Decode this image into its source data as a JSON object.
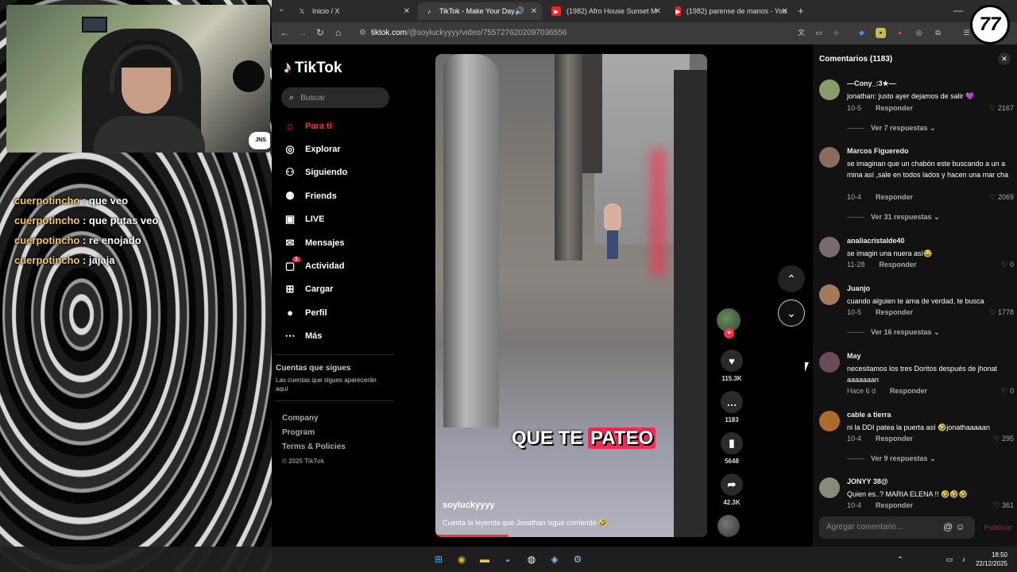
{
  "stream": {
    "chat": [
      {
        "user": "cuerpotincho",
        "msg": ": que veo"
      },
      {
        "user": "cuerpotincho",
        "msg": ": que putas veo"
      },
      {
        "user": "cuerpotincho",
        "msg": ": re enojado"
      },
      {
        "user": "cuerpotincho",
        "msg": ": jajaja"
      }
    ],
    "webcam_badge": "JNS",
    "logo": "77"
  },
  "browser": {
    "tabs": [
      {
        "label": "Inicio / X",
        "icon": "x-logo-icon",
        "active": false
      },
      {
        "label": "TikTok - Make Your Day",
        "icon": "tiktok-logo-icon",
        "active": true
      },
      {
        "label": "(1982) Afro House Sunset M",
        "icon": "youtube-icon",
        "active": false
      },
      {
        "label": "(1982) parense de manos - You",
        "icon": "youtube-icon",
        "active": false
      }
    ],
    "url_host": "tiktok.com",
    "url_path": "/@soyluckyyyy/video/7557276202097036556"
  },
  "tiktok": {
    "logo": "TikTok",
    "search_placeholder": "Buscar",
    "nav": [
      {
        "label": "Para ti",
        "icon": "home-icon",
        "active": true
      },
      {
        "label": "Explorar",
        "icon": "compass-icon"
      },
      {
        "label": "Siguiendo",
        "icon": "following-icon"
      },
      {
        "label": "Friends",
        "icon": "friends-icon"
      },
      {
        "label": "LIVE",
        "icon": "live-icon"
      },
      {
        "label": "Mensajes",
        "icon": "messages-icon"
      },
      {
        "label": "Actividad",
        "icon": "activity-icon",
        "badge": "1"
      },
      {
        "label": "Cargar",
        "icon": "upload-icon"
      },
      {
        "label": "Perfil",
        "icon": "profile-icon"
      },
      {
        "label": "Más",
        "icon": "more-icon"
      }
    ],
    "following_title": "Cuentas que sigues",
    "following_sub": "Las cuentas que sigues aparecerán aquí",
    "footer": {
      "company": "Company",
      "program": "Program",
      "terms": "Terms & Policies",
      "copyright": "© 2025 TikTok"
    },
    "video": {
      "caption_a": "QUE TE ",
      "caption_b": "PATEO",
      "author": "soyluckyyyy",
      "description": "Cuenta la leyenda que Jonathan sigue corriendo 🤣",
      "progress": 0.27
    },
    "actions": {
      "likes": "115.3K",
      "comments": "1183",
      "saves": "5648",
      "shares": "42.3K"
    }
  },
  "comments": {
    "title": "Comentarios (1183)",
    "input_placeholder": "Agregar comentario...",
    "post_label": "Publicar",
    "reply_label": "Responder",
    "items": [
      {
        "name": "—Cony_:3★—",
        "text": "jonathan: justo ayer dejamos de salir 💜",
        "date": "10-5",
        "likes": "2167",
        "more": "Ver 7 respuestas",
        "color": "#8a9b6a"
      },
      {
        "name": "Marcos Figueredo",
        "text": "se imaginan que un chabón este buscando a un a mina así ,sale en todos lados y hacen una mar cha",
        "date": "10-4",
        "likes": "2069",
        "more": "Ver 31 respuestas",
        "color": "#8a6b5c"
      },
      {
        "name": "analiacristalde40",
        "text": "se imagin una nuera así😂",
        "date": "11-28",
        "likes": "0",
        "more": "",
        "color": "#7b6a6e"
      },
      {
        "name": "Juanjo",
        "text": "cuando alguien te ama de verdad, te busca",
        "date": "10-5",
        "likes": "1778",
        "more": "Ver 16 respuestas",
        "color": "#a27a5c"
      },
      {
        "name": "May",
        "text": "necesitamos los tres Doritos después de jhonat aaaaaaan",
        "date": "Hace 6 d",
        "likes": "0",
        "more": "",
        "color": "#6b4a5c"
      },
      {
        "name": "cable a tierra",
        "text": "ni la DDI patea la puerta así 🤣jonathaaaaan",
        "date": "10-4",
        "likes": "295",
        "more": "Ver 9 respuestas",
        "color": "#b06a2a"
      },
      {
        "name": "JONYY 38@",
        "text": "Quien es..? MARIA ELENA !! 🤣🤣🤣",
        "date": "10-4",
        "likes": "361",
        "more": "",
        "color": "#8a8a7a"
      }
    ]
  },
  "taskbar": {
    "time": "18:50",
    "date": "22/12/2025"
  },
  "colors": {
    "accent": "#fe2c55",
    "chat_user": "#f0c76b"
  }
}
